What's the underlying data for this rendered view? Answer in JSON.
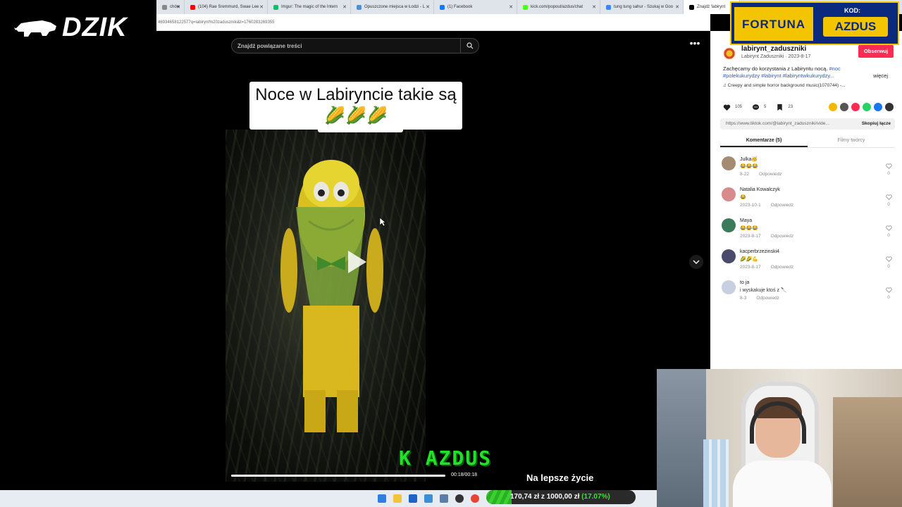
{
  "browser": {
    "tabs": [
      {
        "title": "chów",
        "favicon_color": "#888888"
      },
      {
        "title": "(104) Rae Sremmurd, Swae Lee",
        "favicon_color": "#ff0000"
      },
      {
        "title": "Imgur: The magic of the Intern",
        "favicon_color": "#1bb76e"
      },
      {
        "title": "Opuszczone miejsca w Łodzi - L",
        "favicon_color": "#4a90d9"
      },
      {
        "title": "(1) Facebook",
        "favicon_color": "#1877f2"
      },
      {
        "title": "kick.com/popout/azdus/chat",
        "favicon_color": "#53fc18"
      },
      {
        "title": "tung tung sahur - Szukaj w Goo",
        "favicon_color": "#4285f4"
      },
      {
        "title": "Znajdź 'labirynt",
        "favicon_color": "#000000"
      }
    ],
    "url": "46934658122577q=labirynt%20zaduszniki&t=1760283269355"
  },
  "logo": {
    "text": "DZIK"
  },
  "video": {
    "search_placeholder": "Znajdź powiązane treści",
    "caption": "Noce w Labiryncie takie są 🌽🌽🌽",
    "current_time": "00:18/00:18",
    "progress": 1.0
  },
  "overlay": {
    "code_text": "K AZDUS",
    "slogan": "Na lepsze życie"
  },
  "ad": {
    "brand": "FORTUNA",
    "kod_label": "KOD:",
    "code": "AZDUS"
  },
  "panel": {
    "author_handle": "labirynt_zaduszniki",
    "author_sub": "Labirynt Zaduszniki · 2023-8-17",
    "follow_label": "Obserwuj",
    "description": "Zachęcamy do korzystania z Labiryntu nocą.",
    "tags": "#noc #polekukurydzy #labirynt #labiryntwkukurydzy...",
    "more_label": "więcej",
    "music": "♫  Creepy and simple horror background music(1070744) -...",
    "likes": "105",
    "comments_count": "5",
    "saves": "23",
    "share_colors": [
      "#f5b800",
      "#555555",
      "#fe2c55",
      "#25d366",
      "#1877f2",
      "#333333"
    ],
    "link": "https://www.tiktok.com/@labirynt_zaduszniki/vide...",
    "copy_label": "Skopiuj łącze",
    "tab_comments": "Komentarze (5)",
    "tab_creator": "Filmy twórcy",
    "comments": [
      {
        "name": "Julka🥳",
        "text": "😂😂😂",
        "date": "8-22",
        "reply": "Odpowiedz",
        "likes": "0",
        "avatar_color": "#a38b74"
      },
      {
        "name": "Natalia Kowalczyk",
        "text": "😂",
        "date": "2023-10-1",
        "reply": "Odpowiedz",
        "likes": "0",
        "avatar_color": "#d98a8a"
      },
      {
        "name": "Maya",
        "text": "😂😂😂",
        "date": "2023-8-17",
        "reply": "Odpowiedz",
        "likes": "0",
        "avatar_color": "#3b7a5a"
      },
      {
        "name": "kacperbrzezinski4",
        "text": "🌽🌽💪",
        "date": "2023-8-17",
        "reply": "Odpowiedz",
        "likes": "0",
        "avatar_color": "#4a4a6a"
      },
      {
        "name": "to ja",
        "text": "i wyskakuje ktoś z 🔪",
        "date": "8-3",
        "reply": "Odpowiedz",
        "likes": "0",
        "avatar_color": "#c8cfe0"
      }
    ]
  },
  "donation": {
    "text": "170,74 zł z 1000,00 zł",
    "percent_text": "(17.07%)",
    "fraction": 0.1707
  },
  "colors": {
    "accent": "#fe2c55",
    "goal_green": "#38e42e",
    "ad_yellow": "#f2c500",
    "ad_blue": "#0b2a7d"
  }
}
